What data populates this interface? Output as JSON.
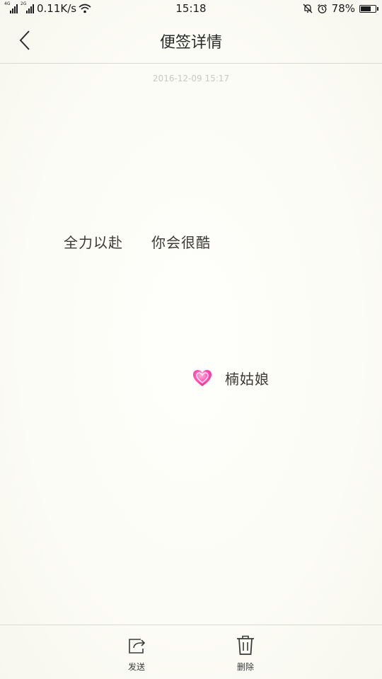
{
  "status_bar": {
    "net_speed": "0.11K/s",
    "time": "15:18",
    "battery": "78%",
    "battery_level": 0.78,
    "sim1_tag": "4G",
    "sim2_tag": "2G"
  },
  "header": {
    "title": "便签详情"
  },
  "note": {
    "timestamp": "2016-12-09 15:17",
    "line1_part1": "全力以赴",
    "line1_part2": "你会很酷",
    "line2_emoji": "pink-heart-icon",
    "line2_text": "楠姑娘"
  },
  "toolbar": {
    "send_label": "发送",
    "delete_label": "删除"
  },
  "colors": {
    "background": "#fdfdf8",
    "heart": "#ff3fa4",
    "timestamp": "#c9c9c2"
  }
}
